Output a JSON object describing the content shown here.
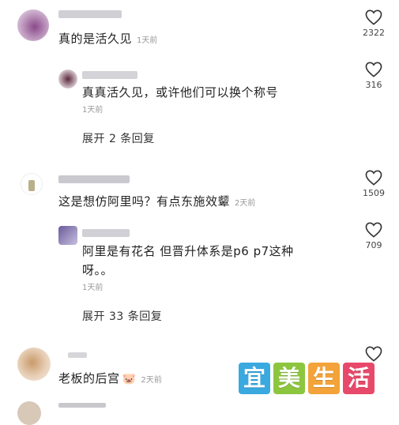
{
  "comments": [
    {
      "text": "真的是活久见",
      "time": "1天前",
      "likes": "2322"
    },
    {
      "text": "真真活久见，或许他们可以换个称号",
      "time": "1天前",
      "likes": "316",
      "expand": "展开 2 条回复"
    },
    {
      "text": "这是想仿阿里吗？有点东施效颦",
      "time": "2天前",
      "likes": "1509"
    },
    {
      "text_line1": "阿里是有花名 但晋升体系是p6 p7这种",
      "text_line2": "呀。。",
      "time": "1天前",
      "likes": "709",
      "expand": "展开 33 条回复"
    },
    {
      "text": "老板的后宫",
      "time": "2天前",
      "emoji": "🐷"
    }
  ],
  "watermark": {
    "chars": [
      "宜",
      "美",
      "生",
      "活"
    ],
    "colors": [
      "#3aa9e0",
      "#8cc63f",
      "#f3a33a",
      "#e8496a"
    ]
  },
  "icons": {
    "like": "heart-outline-icon"
  }
}
